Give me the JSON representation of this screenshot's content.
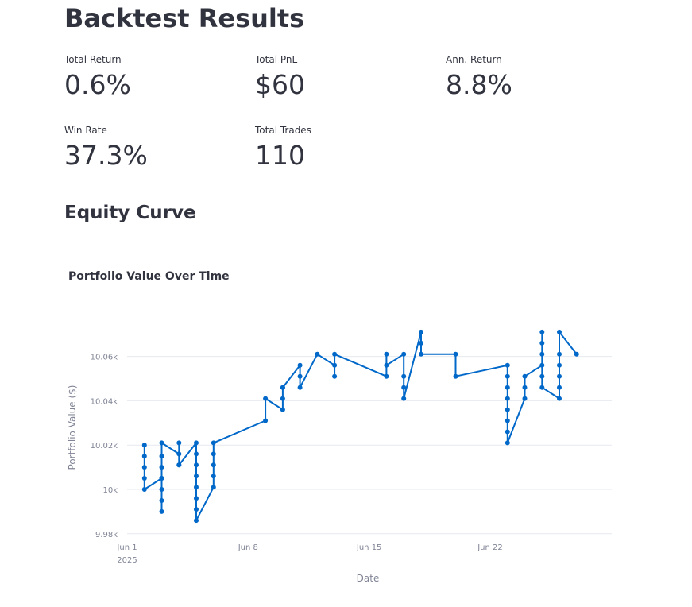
{
  "page": {
    "title": "Backtest Results",
    "section_title": "Equity Curve"
  },
  "metrics": [
    {
      "label": "Total Return",
      "value": "0.6%"
    },
    {
      "label": "Total PnL",
      "value": "$60"
    },
    {
      "label": "Ann. Return",
      "value": "8.8%"
    },
    {
      "label": "Win Rate",
      "value": "37.3%"
    },
    {
      "label": "Total Trades",
      "value": "110"
    }
  ],
  "colors": {
    "line": "#0068c9",
    "grid": "#e6e9ef",
    "axis_text": "#808495"
  },
  "chart_data": {
    "type": "line",
    "title": "Portfolio Value Over Time",
    "xlabel": "Date",
    "ylabel": "Portfolio Value ($)",
    "xlim": [
      "2025-06-01",
      "2025-06-30"
    ],
    "ylim": [
      9980,
      10080
    ],
    "x_ticks": [
      {
        "value": "2025-06-01",
        "label": "Jun 1",
        "sublabel": "2025"
      },
      {
        "value": "2025-06-08",
        "label": "Jun 8",
        "sublabel": ""
      },
      {
        "value": "2025-06-15",
        "label": "Jun 15",
        "sublabel": ""
      },
      {
        "value": "2025-06-22",
        "label": "Jun 22",
        "sublabel": ""
      }
    ],
    "y_ticks": [
      {
        "value": 9980,
        "label": "9.98k"
      },
      {
        "value": 10000,
        "label": "10k"
      },
      {
        "value": 10020,
        "label": "10.02k"
      },
      {
        "value": 10040,
        "label": "10.04k"
      },
      {
        "value": 10060,
        "label": "10.06k"
      }
    ],
    "grid": true,
    "legend": false,
    "series": [
      {
        "x": [
          "2025-06-02",
          "2025-06-02",
          "2025-06-02",
          "2025-06-02",
          "2025-06-02",
          "2025-06-03",
          "2025-06-03",
          "2025-06-03",
          "2025-06-03",
          "2025-06-03",
          "2025-06-03",
          "2025-06-03",
          "2025-06-03",
          "2025-06-04",
          "2025-06-04",
          "2025-06-04",
          "2025-06-04",
          "2025-06-05",
          "2025-06-05",
          "2025-06-05",
          "2025-06-05",
          "2025-06-05",
          "2025-06-05",
          "2025-06-05",
          "2025-06-05",
          "2025-06-06",
          "2025-06-06",
          "2025-06-06",
          "2025-06-06",
          "2025-06-06",
          "2025-06-09",
          "2025-06-09",
          "2025-06-10",
          "2025-06-10",
          "2025-06-10",
          "2025-06-10",
          "2025-06-11",
          "2025-06-11",
          "2025-06-11",
          "2025-06-12",
          "2025-06-13",
          "2025-06-13",
          "2025-06-13",
          "2025-06-16",
          "2025-06-16",
          "2025-06-16",
          "2025-06-17",
          "2025-06-17",
          "2025-06-17",
          "2025-06-17",
          "2025-06-18",
          "2025-06-18",
          "2025-06-18",
          "2025-06-20",
          "2025-06-20",
          "2025-06-23",
          "2025-06-23",
          "2025-06-23",
          "2025-06-23",
          "2025-06-23",
          "2025-06-23",
          "2025-06-23",
          "2025-06-23",
          "2025-06-24",
          "2025-06-24",
          "2025-06-24",
          "2025-06-25",
          "2025-06-25",
          "2025-06-25",
          "2025-06-25",
          "2025-06-25",
          "2025-06-25",
          "2025-06-26",
          "2025-06-26",
          "2025-06-26",
          "2025-06-26",
          "2025-06-26",
          "2025-06-26",
          "2025-06-27"
        ],
        "y": [
          10020,
          10015,
          10010,
          10005,
          10000,
          10005,
          9990,
          9995,
          10000,
          10005,
          10010,
          10015,
          10021,
          10016,
          10011,
          10021,
          10011,
          10021,
          10016,
          10011,
          10006,
          10001,
          9996,
          9991,
          9986,
          10001,
          10006,
          10011,
          10016,
          10021,
          10031,
          10041,
          10036,
          10046,
          10041,
          10046,
          10056,
          10051,
          10046,
          10061,
          10056,
          10051,
          10061,
          10051,
          10061,
          10056,
          10061,
          10051,
          10046,
          10041,
          10071,
          10066,
          10061,
          10061,
          10051,
          10056,
          10051,
          10046,
          10041,
          10036,
          10031,
          10026,
          10021,
          10041,
          10046,
          10051,
          10056,
          10071,
          10066,
          10061,
          10051,
          10046,
          10041,
          10046,
          10051,
          10056,
          10061,
          10071,
          10061
        ]
      }
    ]
  }
}
